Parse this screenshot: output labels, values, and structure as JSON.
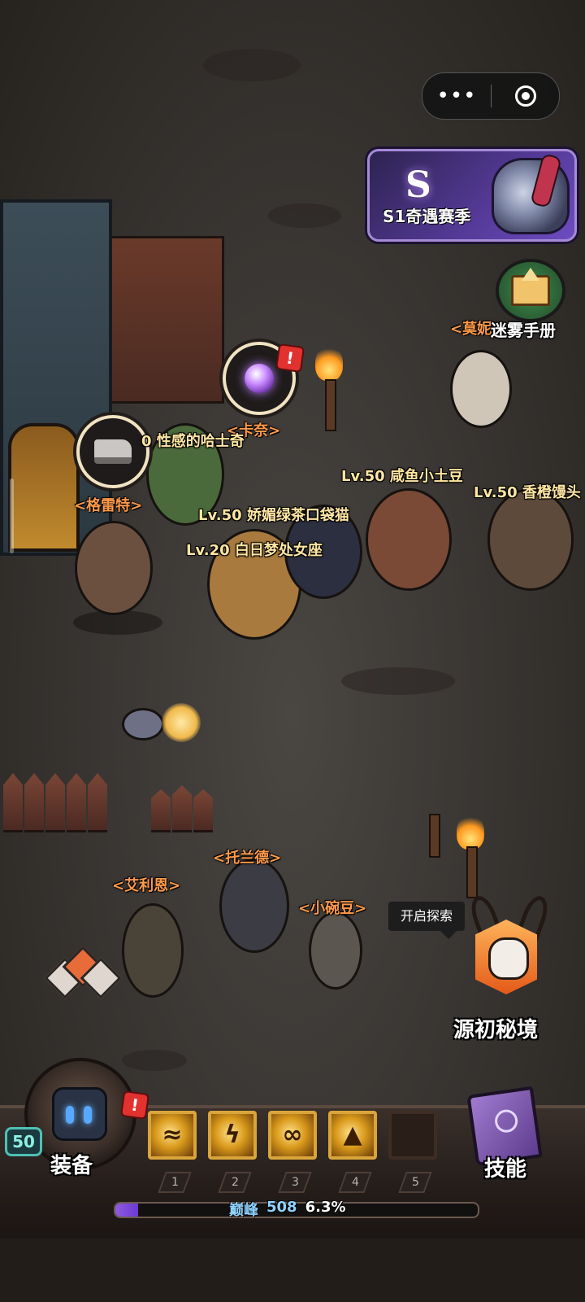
{
  "top_bar": {
    "more_icon": "more-dots-icon",
    "close_icon": "target-circle-icon"
  },
  "season": {
    "logo": "S",
    "title": "S1奇遇赛季"
  },
  "guide": {
    "label": "迷雾手册"
  },
  "npcs": {
    "moni": "<莫妮",
    "kanai": "<卡奈>",
    "geleite": "<格雷特>",
    "tuolande": "<托兰德>",
    "ailien": "<艾利恩>",
    "xiaowandou": "<小碗豆>"
  },
  "players": {
    "p1": "0 性感的哈士奇",
    "p2": "Lv.50 咸鱼小土豆",
    "p3": "Lv.50 香橙馒头",
    "p4": "Lv.50 娇媚绿茶口袋猫",
    "p5": "Lv.20 白日梦处女座"
  },
  "explore": {
    "bubble": "开启探索",
    "realm_label": "源初秘境"
  },
  "hud": {
    "level": "50",
    "equip_label": "装备",
    "skill_label": "技能",
    "alert": "!",
    "slots": [
      {
        "num": "1",
        "icon": "slash-wave-icon",
        "filled": true
      },
      {
        "num": "2",
        "icon": "lightning-burst-icon",
        "filled": true
      },
      {
        "num": "3",
        "icon": "claw-swipe-icon",
        "filled": true
      },
      {
        "num": "4",
        "icon": "demon-helm-icon",
        "filled": true
      },
      {
        "num": "5",
        "icon": "empty-slot",
        "filled": false
      }
    ],
    "rank_label": "巅峰",
    "rank_value": "508",
    "progress_text": "6.3%",
    "progress_fraction": 0.063
  },
  "colors": {
    "npc_name": "#ff9a4a",
    "player_name": "#ffe6a3",
    "season_accent": "#6d4cc0",
    "skill_frame": "#d9a53b",
    "xp_fill": "#8f5be0"
  }
}
